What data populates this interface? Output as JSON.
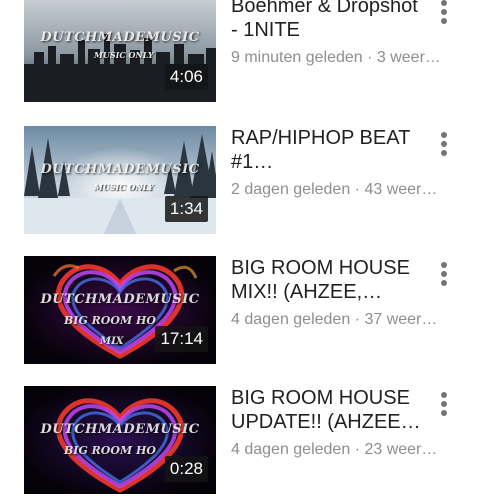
{
  "videos": [
    {
      "title": "Boehmer & Dropshot\n- 1NITE",
      "meta": "9 minuten geleden · 3 weer…",
      "duration": "4:06",
      "watermark": "DUTCHMADEMUSIC",
      "watermark_sub": "MUSIC ONLY"
    },
    {
      "title": "RAP/HIPHOP BEAT\n#1…",
      "meta": "2 dagen geleden · 43 weer…",
      "duration": "1:34",
      "watermark": "DUTCHMADEMUSIC",
      "watermark_sub": "MUSIC ONLY"
    },
    {
      "title": "BIG ROOM HOUSE\nMIX!! (AHZEE,…",
      "meta": "4 dagen geleden · 37 weer…",
      "duration": "17:14",
      "watermark": "DUTCHMADEMUSIC",
      "watermark_sub": "BIG ROOM HO",
      "watermark_sub2": "MIX"
    },
    {
      "title": "BIG ROOM HOUSE\nUPDATE!! (AHZEE…",
      "meta": "4 dagen geleden · 23 weer…",
      "duration": "0:28",
      "watermark": "DUTCHMADEMUSIC",
      "watermark_sub": "BIG ROOM HO"
    }
  ],
  "icons": {
    "menu": "more-vert-icon"
  },
  "colors": {
    "title": "#212121",
    "meta": "#8e8e8e",
    "badge": "#141414"
  }
}
